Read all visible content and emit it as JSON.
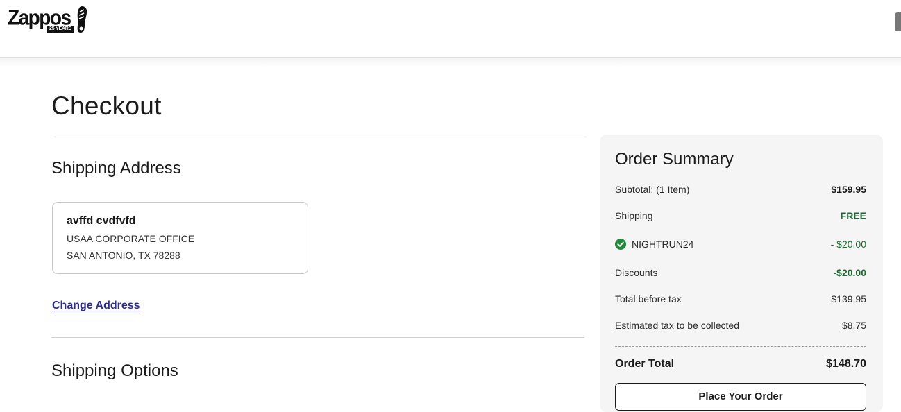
{
  "header": {
    "logo_text": "Zappos",
    "logo_badge": "25 YEARS"
  },
  "page": {
    "title": "Checkout"
  },
  "shipping_address": {
    "section_title": "Shipping Address",
    "name": "avffd cvdfvfd",
    "line1": "USAA CORPORATE OFFICE",
    "line2": "SAN ANTONIO, TX 78288",
    "change_link": "Change Address"
  },
  "shipping_options": {
    "section_title": "Shipping Options"
  },
  "order_summary": {
    "title": "Order Summary",
    "subtotal_label": "Subtotal: (1 Item)",
    "subtotal_value": "$159.95",
    "shipping_label": "Shipping",
    "shipping_value": "FREE",
    "promo_code": "NIGHTRUN24",
    "promo_value": "- $20.00",
    "discounts_label": "Discounts",
    "discounts_value": "-$20.00",
    "before_tax_label": "Total before tax",
    "before_tax_value": "$139.95",
    "tax_label": "Estimated tax to be collected",
    "tax_value": "$8.75",
    "total_label": "Order Total",
    "total_value": "$148.70",
    "place_order_label": "Place Your Order"
  },
  "colors": {
    "discount_green": "#1c6b30",
    "link_blue": "#2a2a9c",
    "summary_bg": "#f5f5f5"
  },
  "icons": [
    "shoe-logo-icon",
    "check-circle-icon",
    "account-icon"
  ]
}
